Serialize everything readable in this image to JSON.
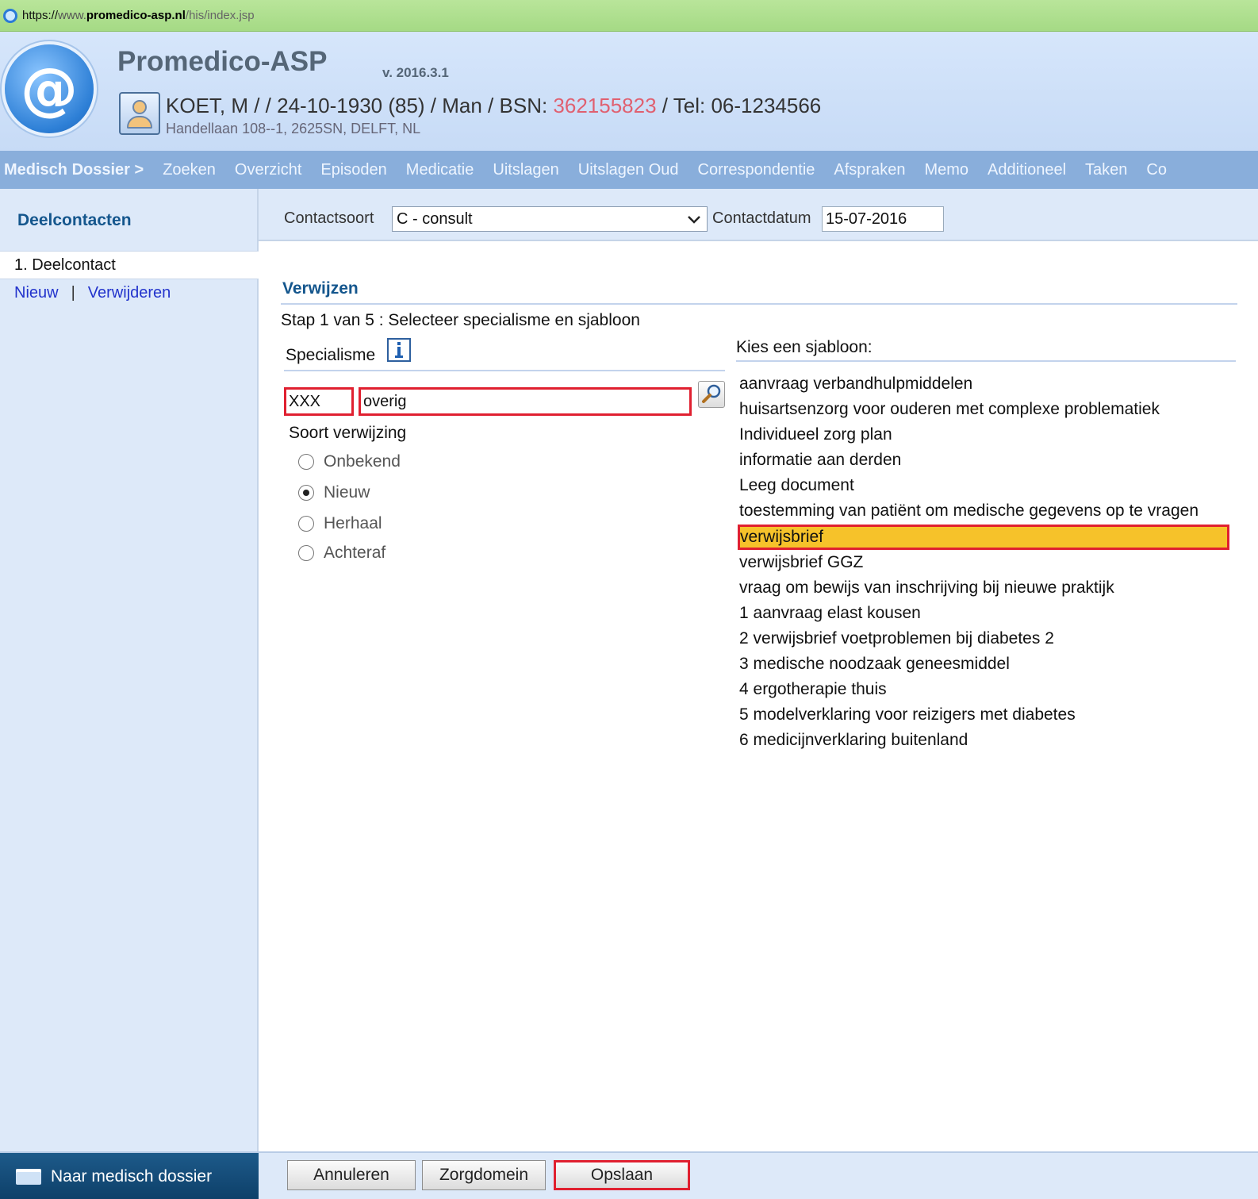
{
  "url": {
    "scheme": "https://",
    "host_prefix": "www.",
    "host": "promedico-asp.nl",
    "path": "/his/index.jsp"
  },
  "header": {
    "logo_glyph": "@",
    "title": "Promedico-ASP",
    "version": "v. 2016.3.1",
    "patient_summary": "KOET, M / / 24-10-1930 (85) / Man / BSN: ",
    "bsn": "362155823",
    "tel": " / Tel: 06-1234566",
    "address": "Handellaan 108--1, 2625SN, DELFT, NL"
  },
  "nav": {
    "dossier": "Medisch Dossier >",
    "items": [
      "Zoeken",
      "Overzicht",
      "Episoden",
      "Medicatie",
      "Uitslagen",
      "Uitslagen Oud",
      "Correspondentie",
      "Afspraken",
      "Memo",
      "Additioneel",
      "Taken",
      "Co"
    ]
  },
  "sidebar": {
    "title": "Deelcontacten",
    "item": "1. Deelcontact",
    "new_link": "Nieuw",
    "separator": "|",
    "delete_link": "Verwijderen"
  },
  "contact": {
    "type_label": "Contactsoort",
    "type_value": "C - consult",
    "date_label": "Contactdatum",
    "date_value": "15-07-2016"
  },
  "referral": {
    "title": "Verwijzen",
    "step": "Stap 1 van 5 : Selecteer specialisme en sjabloon",
    "specialism_label": "Specialisme",
    "code_value": "XXX",
    "name_value": "overig",
    "type_label": "Soort verwijzing",
    "options": [
      {
        "label": "Onbekend",
        "checked": false
      },
      {
        "label": "Nieuw",
        "checked": true
      },
      {
        "label": "Herhaal",
        "checked": false
      },
      {
        "label": "Achteraf",
        "checked": false
      }
    ],
    "template_label": "Kies een sjabloon:",
    "templates": [
      "aanvraag verbandhulpmiddelen",
      "huisartsenzorg voor ouderen met complexe problematiek",
      "Individueel zorg plan",
      "informatie aan derden",
      "Leeg document",
      "toestemming van patiënt om medische gegevens op te vragen",
      "verwijsbrief",
      "verwijsbrief GGZ",
      "vraag om bewijs van inschrijving bij nieuwe praktijk",
      "1 aanvraag elast kousen",
      "2 verwijsbrief voetproblemen bij diabetes 2",
      "3 medische noodzaak geneesmiddel",
      "4 ergotherapie thuis",
      "5 modelverklaring voor reizigers met diabetes",
      "6 medicijnverklaring buitenland"
    ],
    "selected_template": "verwijsbrief"
  },
  "footer": {
    "back_label": "Naar medisch dossier",
    "cancel_label": "Annuleren",
    "zorgdomein_label": "Zorgdomein",
    "save_label": "Opslaan"
  },
  "colors": {
    "accent_title": "#14568d",
    "highlight_border": "#e02030",
    "selected_fill": "#f6c22a",
    "bsn": "#e06070"
  }
}
